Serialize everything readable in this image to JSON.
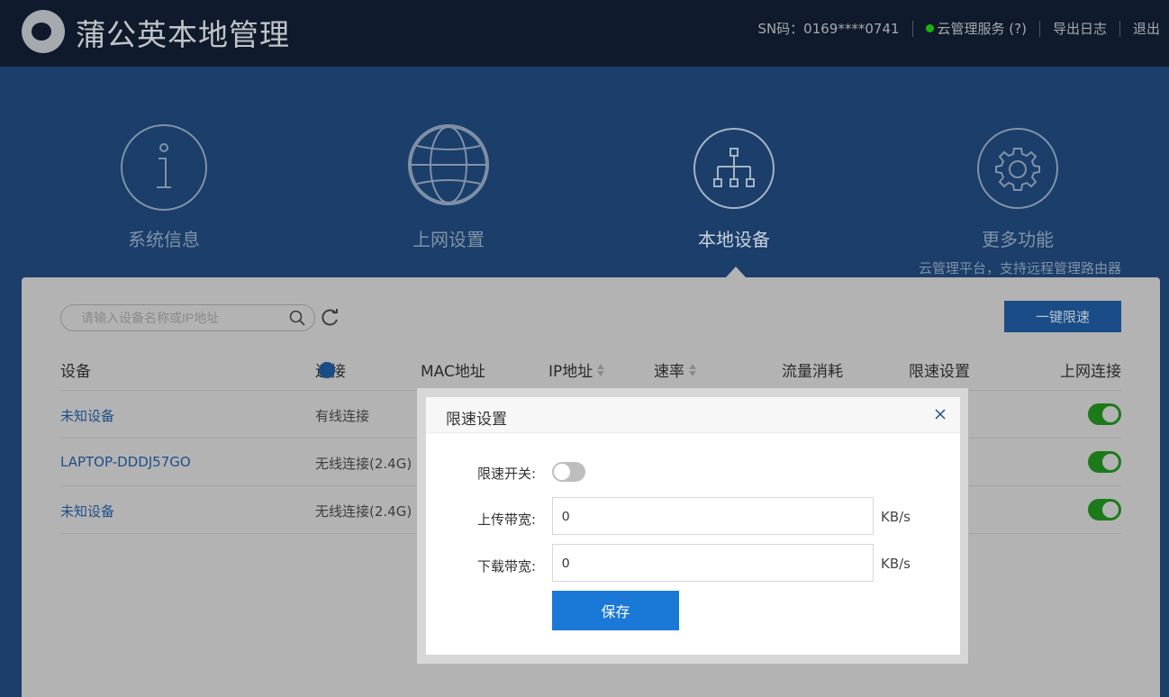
{
  "header": {
    "title": "蒲公英本地管理",
    "sn": "SN码：0169****0741",
    "cloud_service": "云管理服务 (?)",
    "export_log": "导出日志",
    "logout": "退出",
    "status_color": "#1ab40e"
  },
  "nav": {
    "items": [
      {
        "label": "系统信息",
        "icon": "info-icon"
      },
      {
        "label": "上网设置",
        "icon": "globe-icon"
      },
      {
        "label": "本地设备",
        "icon": "network-tree-icon"
      },
      {
        "label": "更多功能",
        "icon": "gear-icon",
        "sub": "云管理平台，支持远程管理路由器"
      }
    ],
    "active": "本地设备"
  },
  "toolbar": {
    "search_placeholder": "请输入设备名称或IP地址",
    "limit_all_label": "一键限速"
  },
  "table": {
    "headers": [
      "设备",
      "连接",
      "MAC地址",
      "IP地址",
      "速率",
      "流量消耗",
      "限速设置",
      "上网连接"
    ],
    "rows": [
      {
        "device": "未知设备",
        "connection": "有线连接",
        "online": true
      },
      {
        "device": "LAPTOP-DDDJ57GO",
        "connection": "无线连接(2.4G)",
        "online": true
      },
      {
        "device": "未知设备",
        "connection": "无线连接(2.4G)",
        "online": true
      }
    ]
  },
  "modal": {
    "title": "限速设置",
    "switch_label": "限速开关:",
    "switch_on": false,
    "upload_label": "上传带宽:",
    "upload_value": "0",
    "download_label": "下载带宽:",
    "download_value": "0",
    "unit": "KB/s",
    "save_label": "保存"
  }
}
